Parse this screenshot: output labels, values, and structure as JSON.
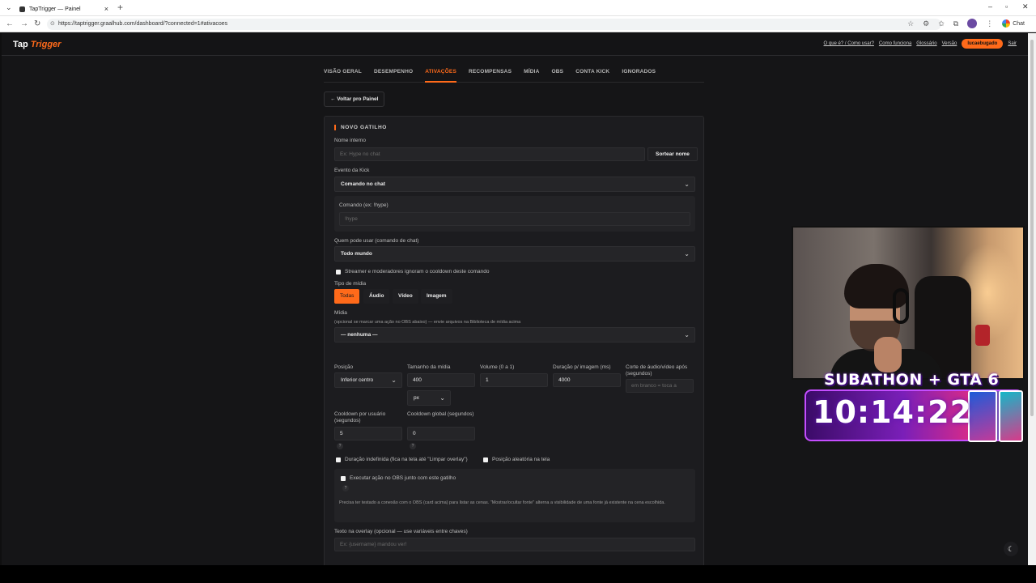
{
  "browser": {
    "tab_title": "TapTrigger — Painel",
    "url": "https://taptrigger.graalhub.com/dashboard/?connected=1#ativacoes",
    "chat_label": "Chat"
  },
  "app": {
    "logo_main": "Tap",
    "logo_accent": "Trigger",
    "top_links": [
      "O que é? / Como usar?",
      "Como funciona",
      "Glossário",
      "Versão"
    ],
    "username": "lucaebugado",
    "logout": "Sair"
  },
  "nav_tabs": [
    "VISÃO GERAL",
    "DESEMPENHO",
    "ATIVAÇÕES",
    "RECOMPENSAS",
    "MÍDIA",
    "OBS",
    "CONTA KICK",
    "IGNORADOS"
  ],
  "back_button": "← Voltar pro Painel",
  "form": {
    "section_title": "NOVO GATILHO",
    "internal_name_label": "Nome interno",
    "internal_name_placeholder": "Ex: Hype no chat",
    "random_name_button": "Sortear nome",
    "event_label": "Evento da Kick",
    "event_value": "Comando no chat",
    "command_label": "Comando (ex: !hype)",
    "command_placeholder": "!hype",
    "who_label": "Quem pode usar (comando de chat)",
    "who_value": "Todo mundo",
    "cooldown_ignore_label": "Streamer e moderadores ignoram o cooldown deste comando",
    "media_type_label": "Tipo de mídia",
    "media_types": [
      "Todas",
      "Áudio",
      "Vídeo",
      "Imagem"
    ],
    "media_label": "Mídia",
    "media_help": "(opcional se marcar uma ação no OBS abaixo) — envie arquivos na Biblioteca de mídia acima",
    "media_value": "— nenhuma —",
    "position_label": "Posição",
    "position_value": "Inferior centro",
    "size_label": "Tamanho da mídia",
    "size_value": "400",
    "size_unit": "px",
    "volume_label": "Volume (0 a 1)",
    "volume_value": "1",
    "duration_label": "Duração p/ imagem (ms)",
    "duration_value": "4000",
    "cut_label": "Corte de áudio/vídeo após (segundos)",
    "cut_placeholder": "em branco = toca a",
    "cooldown_user_label": "Cooldown por usuário (segundos)",
    "cooldown_user_value": "5",
    "cooldown_global_label": "Cooldown global (segundos)",
    "cooldown_global_value": "0",
    "qmark": "?",
    "indefinite_label": "Duração indefinida (fica na tela até \"Limpar overlay\")",
    "random_pos_label": "Posição aleatória na tela",
    "obs_action_label": "Executar ação no OBS junto com este gatilho",
    "obs_help": "Precisa ter testado a conexão com o OBS (card acima) para listar as cenas. \"Mostrar/ocultar fonte\" alterna a visibilidade de uma fonte já existente na cena escolhida.",
    "overlay_text_label": "Texto na overlay (opcional — use variáveis entre chaves)",
    "overlay_text_placeholder": "Ex: {username} mandou ver!"
  },
  "stream_overlay": {
    "title": "SUBATHON + GTA 6",
    "timer": "10:14:22"
  },
  "theme_icon": "moon-icon",
  "colors": {
    "accent": "#ff6a1a",
    "background": "#151517",
    "card": "#1c1c1f"
  }
}
